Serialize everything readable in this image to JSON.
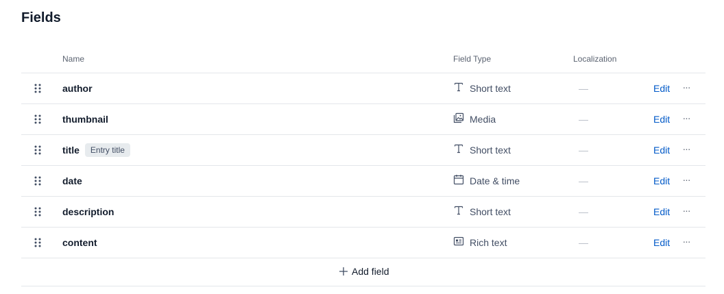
{
  "page": {
    "title": "Fields"
  },
  "columns": {
    "name": "Name",
    "field_type": "Field Type",
    "localization": "Localization"
  },
  "fields": [
    {
      "name": "author",
      "badge": "",
      "type": "Short text",
      "type_icon": "text-icon",
      "localization": "—",
      "edit": "Edit",
      "more": "···"
    },
    {
      "name": "thumbnail",
      "badge": "",
      "type": "Media",
      "type_icon": "media-icon",
      "localization": "—",
      "edit": "Edit",
      "more": "···"
    },
    {
      "name": "title",
      "badge": "Entry title",
      "type": "Short text",
      "type_icon": "text-icon",
      "localization": "—",
      "edit": "Edit",
      "more": "···"
    },
    {
      "name": "date",
      "badge": "",
      "type": "Date & time",
      "type_icon": "calendar-icon",
      "localization": "—",
      "edit": "Edit",
      "more": "···"
    },
    {
      "name": "description",
      "badge": "",
      "type": "Short text",
      "type_icon": "text-icon",
      "localization": "—",
      "edit": "Edit",
      "more": "···"
    },
    {
      "name": "content",
      "badge": "",
      "type": "Rich text",
      "type_icon": "rich-text-icon",
      "localization": "—",
      "edit": "Edit",
      "more": "···"
    }
  ],
  "add_field": {
    "label": "Add field"
  },
  "colors": {
    "accent": "#0059c8",
    "text": "#111b2b",
    "muted": "#5a6270",
    "border": "#e3e6ea"
  }
}
